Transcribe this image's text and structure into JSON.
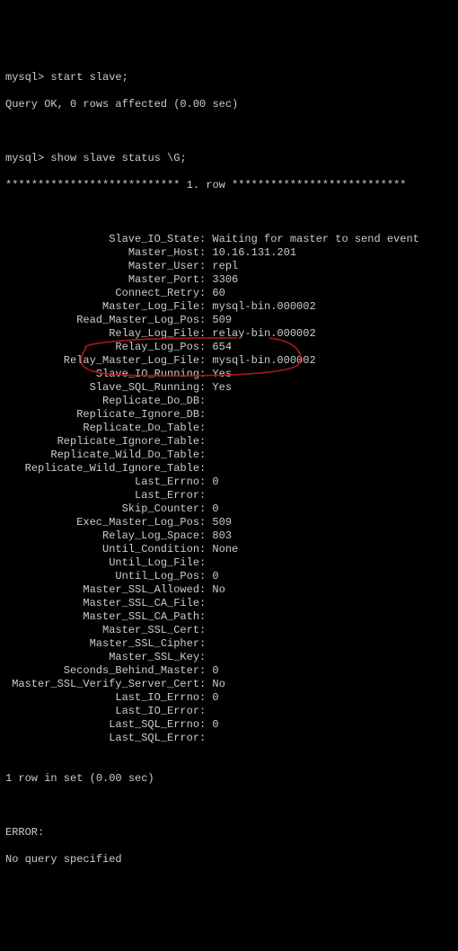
{
  "prompt": "mysql>",
  "cmd1": "start slave;",
  "cmd1_result": "Query OK, 0 rows affected (0.00 sec)",
  "cmd2": "show slave status \\G;",
  "row_header_stars_left": "***************************",
  "row_header_mid": " 1. row ",
  "row_header_stars_right": "***************************",
  "fields": [
    {
      "k": "Slave_IO_State",
      "v": "Waiting for master to send event"
    },
    {
      "k": "Master_Host",
      "v": "10.16.131.201"
    },
    {
      "k": "Master_User",
      "v": "repl"
    },
    {
      "k": "Master_Port",
      "v": "3306"
    },
    {
      "k": "Connect_Retry",
      "v": "60"
    },
    {
      "k": "Master_Log_File",
      "v": "mysql-bin.000002"
    },
    {
      "k": "Read_Master_Log_Pos",
      "v": "509"
    },
    {
      "k": "Relay_Log_File",
      "v": "relay-bin.000002"
    },
    {
      "k": "Relay_Log_Pos",
      "v": "654"
    },
    {
      "k": "Relay_Master_Log_File",
      "v": "mysql-bin.000002"
    },
    {
      "k": "Slave_IO_Running",
      "v": "Yes"
    },
    {
      "k": "Slave_SQL_Running",
      "v": "Yes"
    },
    {
      "k": "Replicate_Do_DB",
      "v": ""
    },
    {
      "k": "Replicate_Ignore_DB",
      "v": ""
    },
    {
      "k": "Replicate_Do_Table",
      "v": ""
    },
    {
      "k": "Replicate_Ignore_Table",
      "v": ""
    },
    {
      "k": "Replicate_Wild_Do_Table",
      "v": ""
    },
    {
      "k": "Replicate_Wild_Ignore_Table",
      "v": ""
    },
    {
      "k": "Last_Errno",
      "v": "0"
    },
    {
      "k": "Last_Error",
      "v": ""
    },
    {
      "k": "Skip_Counter",
      "v": "0"
    },
    {
      "k": "Exec_Master_Log_Pos",
      "v": "509"
    },
    {
      "k": "Relay_Log_Space",
      "v": "803"
    },
    {
      "k": "Until_Condition",
      "v": "None"
    },
    {
      "k": "Until_Log_File",
      "v": ""
    },
    {
      "k": "Until_Log_Pos",
      "v": "0"
    },
    {
      "k": "Master_SSL_Allowed",
      "v": "No"
    },
    {
      "k": "Master_SSL_CA_File",
      "v": ""
    },
    {
      "k": "Master_SSL_CA_Path",
      "v": ""
    },
    {
      "k": "Master_SSL_Cert",
      "v": ""
    },
    {
      "k": "Master_SSL_Cipher",
      "v": ""
    },
    {
      "k": "Master_SSL_Key",
      "v": ""
    },
    {
      "k": "Seconds_Behind_Master",
      "v": "0"
    },
    {
      "k": "Master_SSL_Verify_Server_Cert",
      "v": "No"
    },
    {
      "k": "Last_IO_Errno",
      "v": "0"
    },
    {
      "k": "Last_IO_Error",
      "v": ""
    },
    {
      "k": "Last_SQL_Errno",
      "v": "0"
    },
    {
      "k": "Last_SQL_Error",
      "v": ""
    }
  ],
  "footer1": "1 row in set (0.00 sec)",
  "err_label": "ERROR:",
  "err_msg": "No query specified"
}
